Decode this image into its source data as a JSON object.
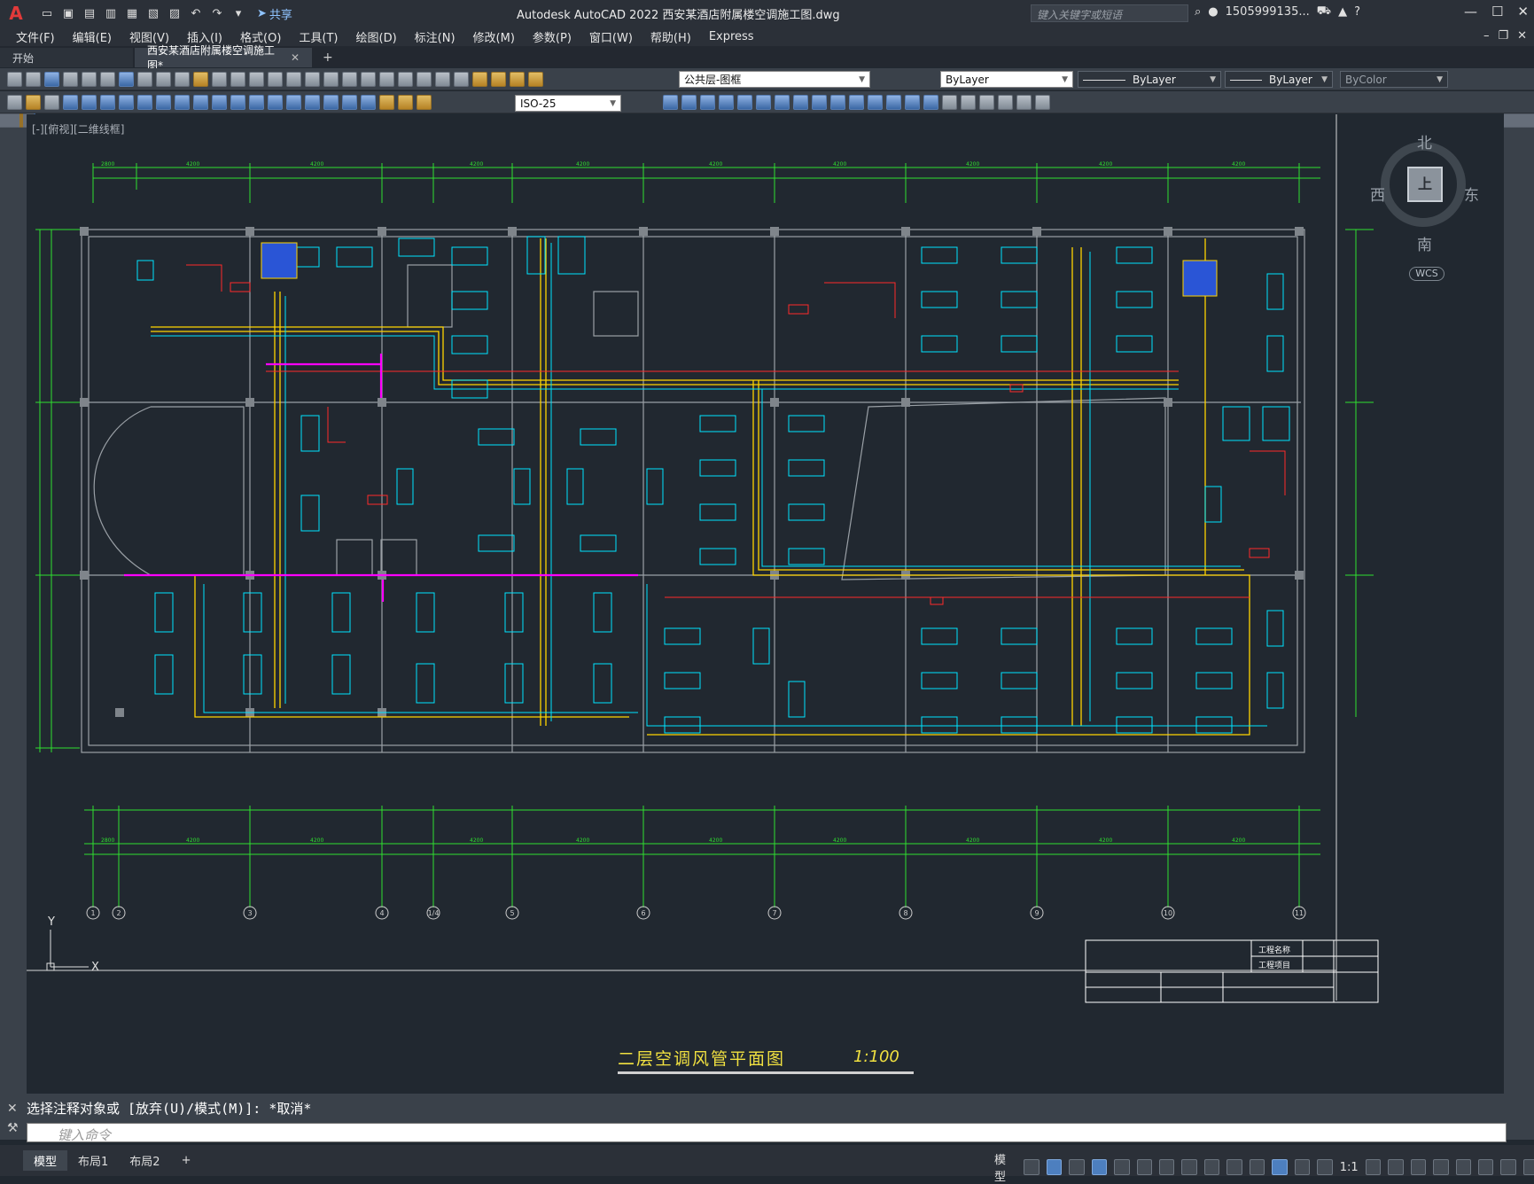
{
  "app": {
    "logo": "A",
    "title": "Autodesk AutoCAD 2022    西安某酒店附属楼空调施工图.dwg",
    "search_placeholder": "键入关键字或短语",
    "user": "1505999135...",
    "share_label": "共享"
  },
  "menu": [
    "文件(F)",
    "编辑(E)",
    "视图(V)",
    "插入(I)",
    "格式(O)",
    "工具(T)",
    "绘图(D)",
    "标注(N)",
    "修改(M)",
    "参数(P)",
    "窗口(W)",
    "帮助(H)",
    "Express"
  ],
  "tabs": [
    {
      "label": "开始",
      "active": false
    },
    {
      "label": "西安某酒店附属楼空调施工图*",
      "active": true
    }
  ],
  "toolbar": {
    "layer": "公共层-图框",
    "color": "ByLayer",
    "linetype": "ByLayer",
    "lineweight": "ByLayer",
    "plotstyle": "ByColor",
    "dimstyle": "ISO-25"
  },
  "viewport": {
    "label": "[-][俯视][二维线框]",
    "compass": {
      "north": "北",
      "south": "南",
      "west": "西",
      "east": "东",
      "top": "上",
      "wcs": "WCS"
    },
    "ucs_x": "X",
    "ucs_y": "Y"
  },
  "drawing": {
    "title": "二层空调风管平面图",
    "scale": "1:100",
    "axis_labels": [
      "1",
      "2",
      "3",
      "4",
      "1/4",
      "5",
      "6",
      "7",
      "8",
      "9",
      "10",
      "11"
    ],
    "titleblock": {
      "project_name": "工程名称",
      "project_item": "工程项目"
    }
  },
  "command": {
    "history": "选择注释对象或 [放弃(U)/模式(M)]: *取消*",
    "placeholder": "键入命令"
  },
  "layout_tabs": [
    {
      "label": "模型",
      "active": true
    },
    {
      "label": "布局1",
      "active": false
    },
    {
      "label": "布局2",
      "active": false
    }
  ],
  "status": {
    "model_label": "模型",
    "scale": "1:1"
  }
}
